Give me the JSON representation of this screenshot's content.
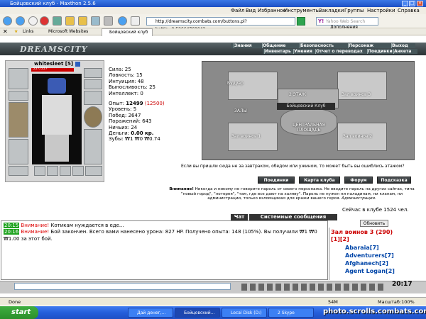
{
  "window": {
    "title": "Бойцовский клуб - Maxthon 2.5.6"
  },
  "menu": [
    "Файл",
    "Вид",
    "Избранное",
    "Инструменты",
    "Закладки",
    "Группы",
    "Настройки",
    "Справка"
  ],
  "address": {
    "url": "http://dreamscity.combats.com/buttons.pl?battle=0.52664768042"
  },
  "search": {
    "placeholder": "Yahoo Web Search"
  },
  "addons_label": "Дополнения",
  "bookmarks": {
    "links": "Links",
    "ms": "Microsoft Websites"
  },
  "tabs": [
    {
      "label": "Бойцовский клуб"
    }
  ],
  "game": {
    "logo": "DREAMSCITY",
    "nav_top": [
      "Знания",
      "Общение",
      "Безопасность",
      "Персонаж",
      "Выход"
    ],
    "nav_bottom": [
      "Инвентарь",
      "Умения",
      "Отчет о переводах",
      "Поединки",
      "Анкета"
    ]
  },
  "character": {
    "name": "whitesleet",
    "level": "[5]",
    "hp": "337/337",
    "stats": {
      "str": "Сила: 25",
      "agi": "Ловкость: 15",
      "int": "Интуиция: 48",
      "end": "Выносливость: 25",
      "intel": "Интеллект: 0",
      "exp_label": "Опыт: ",
      "exp_value": "12499",
      "exp_next": "(12500)",
      "level_line": "Уровень: 5",
      "wins": "Побед: 2647",
      "losses": "Поражений: 643",
      "draws": "Ничьих: 24",
      "money_label": "Деньги: ",
      "money_value": "0.00 кр.",
      "teeth": "Зубы: ₩1 ₩0 ₩0.74"
    }
  },
  "map": {
    "labels": [
      "Будуар",
      "Зал воинов 3",
      "2 ЭТАЖ",
      "Бойцовский Клуб",
      "ЗАЛЫ",
      "ЦЕНТРАЛЬНАЯ ПЛОЩАДЬ",
      "Зал воинов 1",
      "Зал воинов 2"
    ]
  },
  "map_note": "Если вы пришли сюда не за завтраком, обедом или ужином, то может быть вы ошиблись этажом?",
  "buttons": {
    "fights": "Поединки",
    "clubmap": "Карта клуба",
    "forum": "Форум",
    "hint": "Подсказка",
    "refresh": "Обновить"
  },
  "warning": {
    "lead": "Внимание!",
    "text": "Никогда и никому не говорите пароль от своего персонажа. Не вводите пароль на других сайтах, типа \"новый город\", \"лотерея\", \"там, где все дают на халяву\". Пароль не нужен ни паладинам, ни кланам, ни администрации, только взломщикам для кражи вашего героя.",
    "sign": "Администрация."
  },
  "online": "Сейчас в клубе 1524 чел.",
  "chat": {
    "tab_chat": "Чат",
    "tab_sys": "Системные сообщения",
    "lines": [
      {
        "time": "20:15",
        "warn": "Внимание!",
        "text": " Котикам нуждается в еде..."
      },
      {
        "time": "20:16",
        "warn": "Внимание!",
        "text": " Бой закончен. Всего вами нанесено урона: 827 HP. Получено опыта: 148 (105%). Вы получили ₩1 ₩0 ₩1.00 за этот бой."
      }
    ]
  },
  "room": {
    "title": "Зал воинов 3 (290)",
    "pages": "[1][2]",
    "users": [
      "Abaraia[7]",
      "Adventurers[7]",
      "Afghanech[2]",
      "Agent Logan[2]"
    ]
  },
  "clock": "20:17",
  "status": {
    "left": "Done",
    "mem": "54M",
    "zoom": "Масштаб:100%"
  },
  "taskbar": {
    "start": "start",
    "tasks": [
      "Дай денег,...",
      "Бойцовский...",
      "Local Disk (D:)",
      "2 Skype"
    ]
  },
  "watermark": "photo.scrolls.combats.com"
}
